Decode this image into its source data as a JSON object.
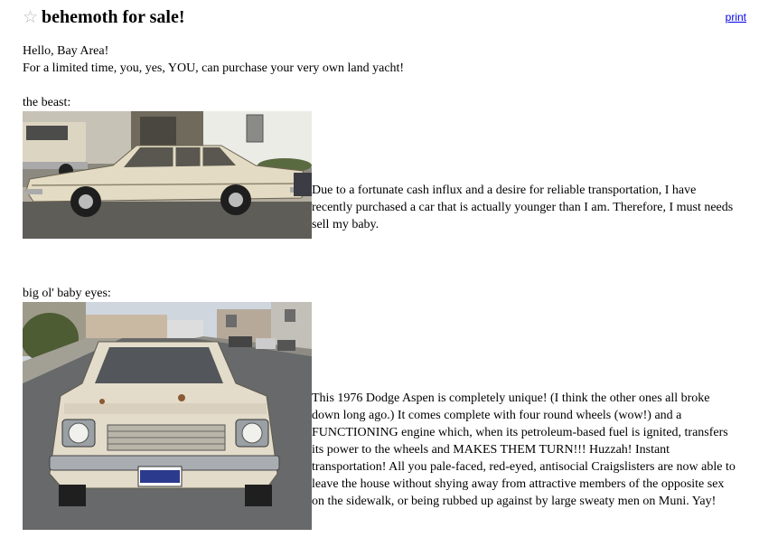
{
  "post": {
    "title": "behemoth for sale!",
    "star_icon": "star-icon",
    "print_label": "print"
  },
  "intro": {
    "line1": "Hello, Bay Area!",
    "line2": "For a limited time, you, yes, YOU, can purchase your very own land yacht!"
  },
  "sections": [
    {
      "caption": "the beast:",
      "photo": "side-view-car-photo",
      "text": "Due to a fortunate cash influx and a desire for reliable transportation, I have recently purchased a car that is actually younger than I am. Therefore, I must needs sell my baby."
    },
    {
      "caption": "big ol' baby eyes:",
      "photo": "front-view-car-photo",
      "text": "This 1976 Dodge Aspen is completely unique! (I think the other ones all broke down long ago.) It comes complete with four round wheels (wow!) and a FUNCTIONING engine which, when its petroleum-based fuel is ignited, transfers its power to the wheels and MAKES THEM TURN!!! Huzzah! Instant transportation! All you pale-faced, red-eyed, antisocial Craigslisters are now able to leave the house without shying away from attractive members of the opposite sex on the sidewalk, or being rubbed up against by large sweaty men on Muni. Yay!"
    }
  ]
}
